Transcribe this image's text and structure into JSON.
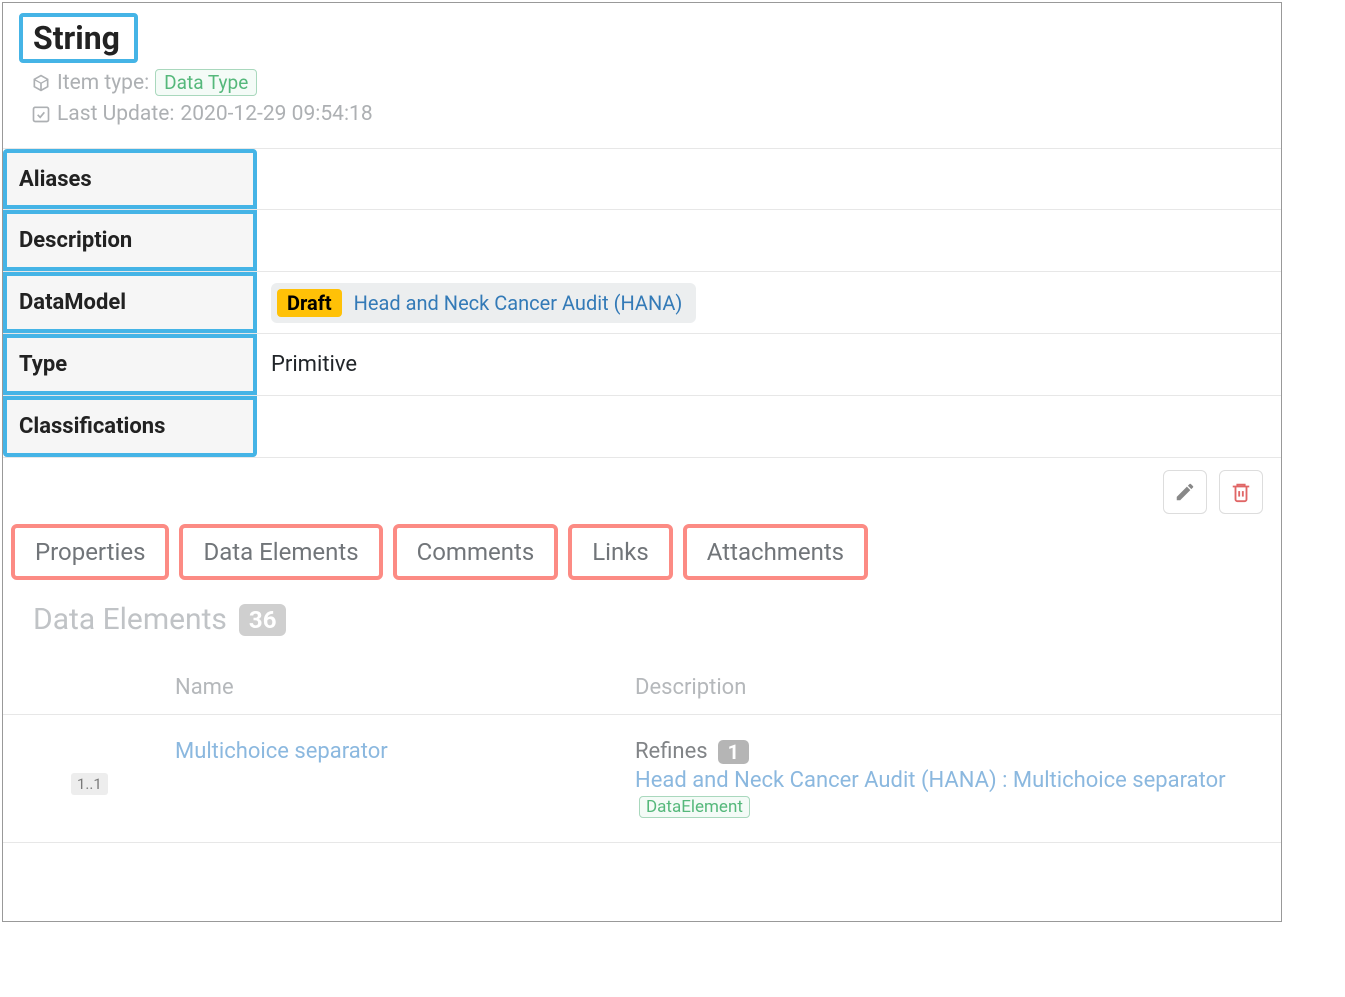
{
  "header": {
    "title": "String",
    "itemTypeLabel": "Item type:",
    "itemTypeValue": "Data Type",
    "lastUpdateLabel": "Last Update:",
    "lastUpdateValue": "2020-12-29 09:54:18"
  },
  "details": {
    "labels": {
      "aliases": "Aliases",
      "description": "Description",
      "dataModel": "DataModel",
      "type": "Type",
      "classifications": "Classifications"
    },
    "values": {
      "aliases": "",
      "description": "",
      "dataModelBadge": "Draft",
      "dataModelLink": "Head and Neck Cancer Audit (HANA)",
      "type": "Primitive",
      "classifications": ""
    }
  },
  "tabs": [
    "Properties",
    "Data Elements",
    "Comments",
    "Links",
    "Attachments"
  ],
  "section": {
    "title": "Data Elements",
    "count": "36"
  },
  "table": {
    "headers": {
      "name": "Name",
      "description": "Description"
    },
    "row": {
      "multiplicity": "1..1",
      "name": "Multichoice separator",
      "refinesLabel": "Refines",
      "refinesCount": "1",
      "refLink": "Head and Neck Cancer Audit (HANA) : Multichoice separator",
      "refTag": "DataElement"
    }
  }
}
